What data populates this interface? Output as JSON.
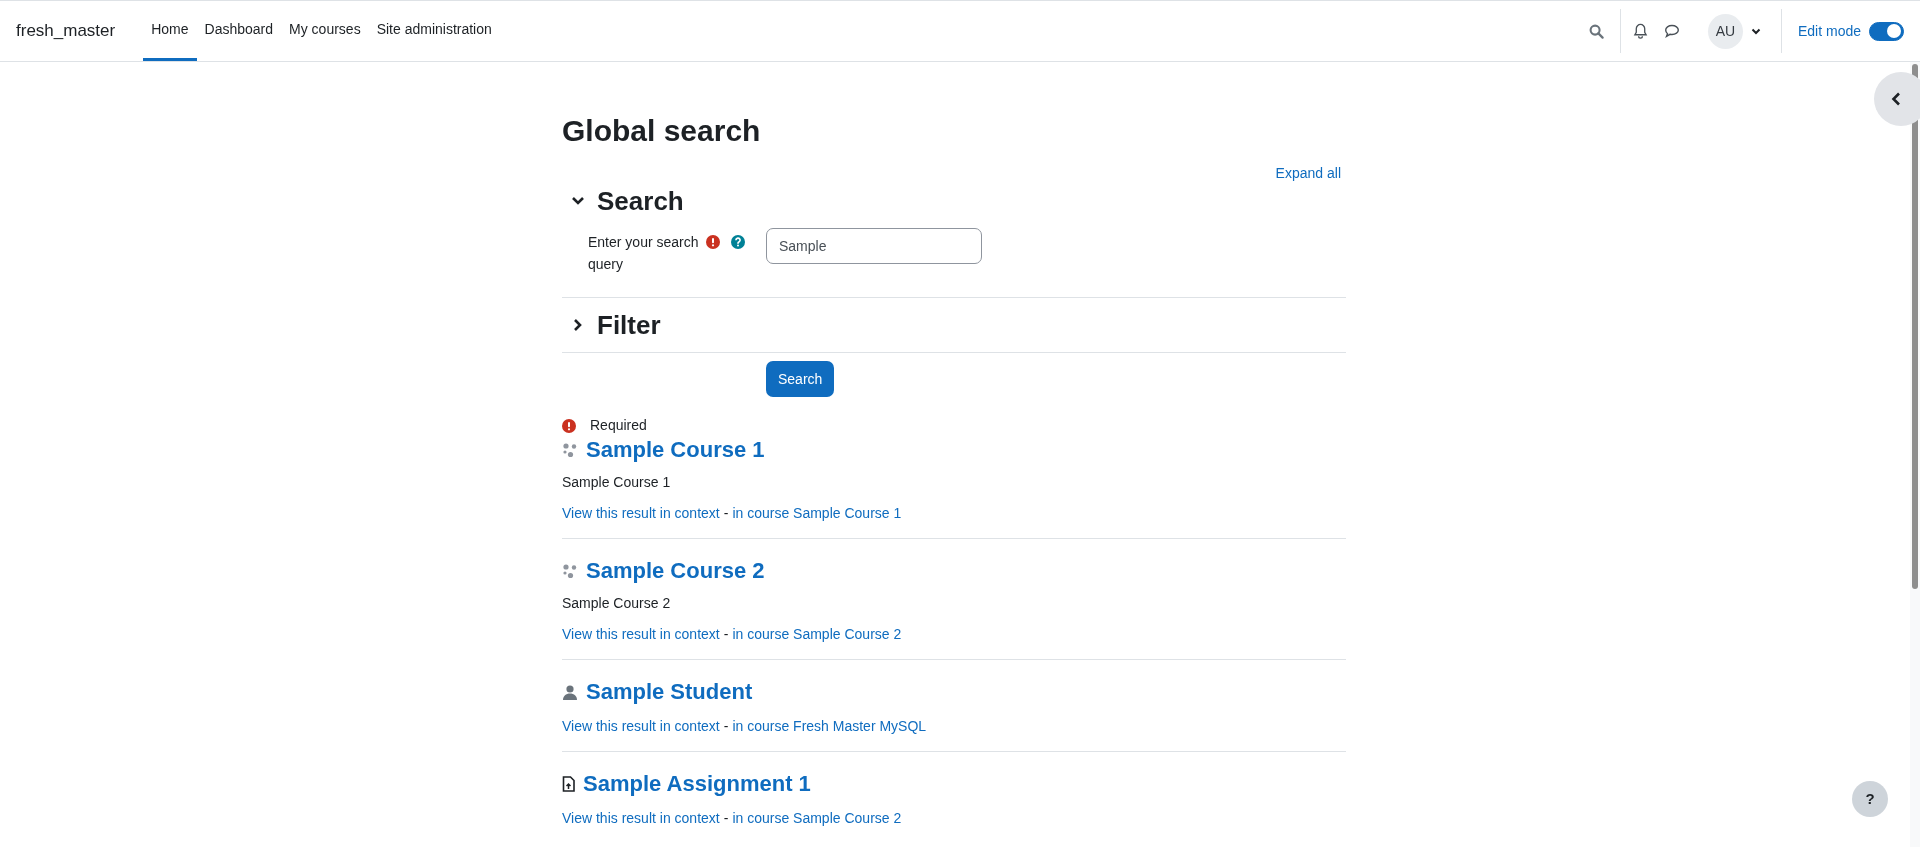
{
  "navbar": {
    "brand": "fresh_master",
    "items": [
      {
        "label": "Home",
        "selected": true
      },
      {
        "label": "Dashboard",
        "selected": false
      },
      {
        "label": "My courses",
        "selected": false
      },
      {
        "label": "Site administration",
        "selected": false
      }
    ],
    "avatar": "AU",
    "edit_mode": {
      "label": "Edit mode",
      "on": true
    }
  },
  "page_title": "Global search",
  "expand_all": "Expand all",
  "sections": [
    {
      "title": "Search",
      "expanded": true,
      "field": {
        "label": "Enter your search query",
        "value": "Sample",
        "required": true
      }
    },
    {
      "title": "Filter",
      "expanded": false
    }
  ],
  "submit": "Search",
  "required_legend": "Required",
  "results": [
    {
      "kind": "course",
      "title": "Sample Course 1",
      "description": "Sample Course 1",
      "context_link": "View this result in context",
      "separator": "-",
      "course_link": "in course Sample Course 1"
    },
    {
      "kind": "course",
      "title": "Sample Course 2",
      "description": "Sample Course 2",
      "context_link": "View this result in context",
      "separator": "-",
      "course_link": "in course Sample Course 2"
    },
    {
      "kind": "user",
      "title": "Sample Student",
      "context_link": "View this result in context",
      "separator": "-",
      "course_link": "in course Fresh Master MySQL"
    },
    {
      "kind": "assignment",
      "title": "Sample Assignment 1",
      "context_link": "View this result in context",
      "separator": "-",
      "course_link": "in course Sample Course 2"
    }
  ],
  "help_button": "?"
}
